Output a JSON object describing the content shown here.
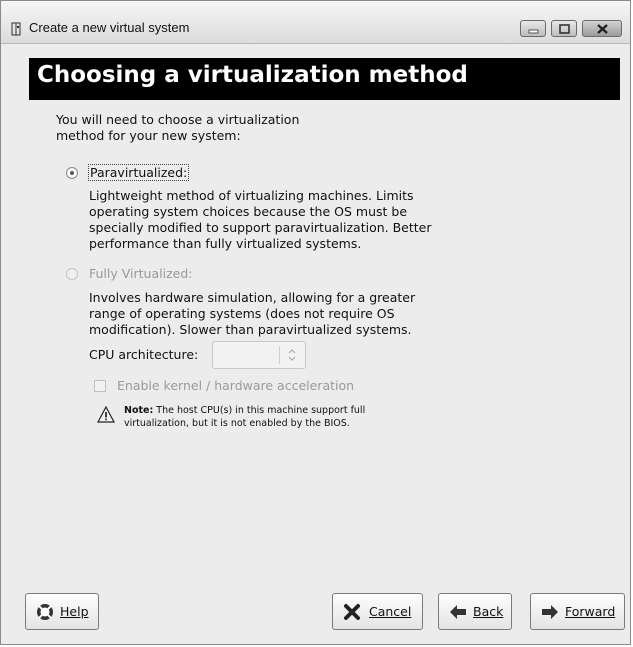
{
  "window": {
    "title": "Create a new virtual system"
  },
  "banner": {
    "title": "Choosing a virtualization method"
  },
  "intro": {
    "line1": "You will need to choose a virtualization",
    "line2": "method for your new system:"
  },
  "options": {
    "paravirtualized": {
      "label": "Paravirtualized:",
      "selected": true,
      "desc": [
        "Lightweight method of virtualizing machines. Limits",
        "operating system choices because the OS must be",
        "specially modified to support paravirtualization. Better",
        "performance than fully virtualized systems."
      ]
    },
    "fully_virtualized": {
      "label": "Fully Virtualized:",
      "selected": false,
      "enabled": false,
      "desc": [
        "Involves hardware simulation, allowing for a greater",
        "range of operating systems (does not require OS",
        "modification). Slower than paravirtualized systems."
      ]
    }
  },
  "cpu": {
    "label": "CPU architecture:",
    "value": ""
  },
  "acceleration": {
    "label": "Enable kernel / hardware acceleration",
    "checked": false,
    "enabled": false
  },
  "note": {
    "bold": "Note:",
    "line1": " The host CPU(s) in this machine support full",
    "line2": "virtualization, but it is not enabled by the BIOS."
  },
  "buttons": {
    "help": "Help",
    "cancel": "Cancel",
    "back": "Back",
    "forward": "Forward"
  },
  "icons": {
    "window": "window-icon",
    "warning": "warning-icon",
    "help": "help-icon",
    "cancel": "cancel-icon",
    "back": "back-arrow-icon",
    "forward": "forward-arrow-icon"
  }
}
